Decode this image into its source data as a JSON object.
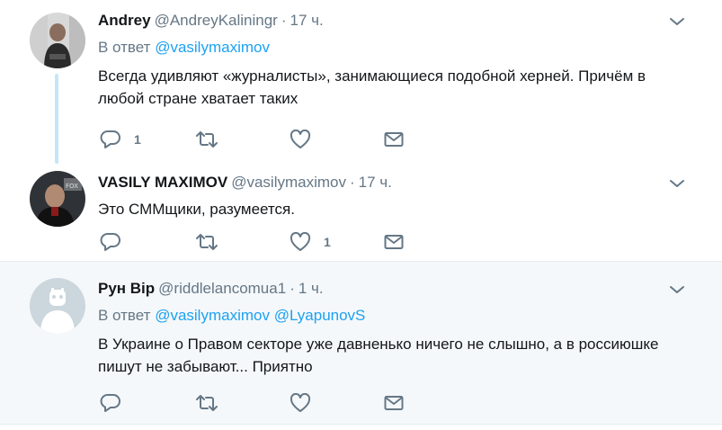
{
  "tweets": [
    {
      "author": "Andrey",
      "handle": "@AndreyKaliningr",
      "time": "17 ч.",
      "reply_to_label": "В ответ",
      "reply_to": [
        "@vasilymaximov"
      ],
      "text": "Всегда удивляют «журналисты», занимающиеся подобной херней. Причём в любой стране хватает таких",
      "reply_count": "1",
      "like_count": ""
    },
    {
      "author": "VASILY MAXIMOV",
      "handle": "@vasilymaximov",
      "time": "17 ч.",
      "text": "Это СММщики, разумеется.",
      "reply_count": "",
      "like_count": "1"
    },
    {
      "author": "Рун Вір",
      "handle": "@riddlelancomua1",
      "time": "1 ч.",
      "reply_to_label": "В ответ",
      "reply_to": [
        "@vasilymaximov",
        "@LyapunovS"
      ],
      "text": "В Украине о Правом секторе уже давненько ничего не слышно, а в россиюшке пишут не забывают... Приятно",
      "reply_count": "",
      "like_count": ""
    }
  ],
  "separator": "·",
  "icons": {
    "reply": "reply-icon",
    "retweet": "retweet-icon",
    "like": "heart-icon",
    "dm": "envelope-icon",
    "caret": "chevron-down-icon"
  },
  "colors": {
    "link": "#1da1f2",
    "secondary": "#657786",
    "thread_line": "#c4e6fb",
    "highlight_bg": "#f5f8fa"
  }
}
